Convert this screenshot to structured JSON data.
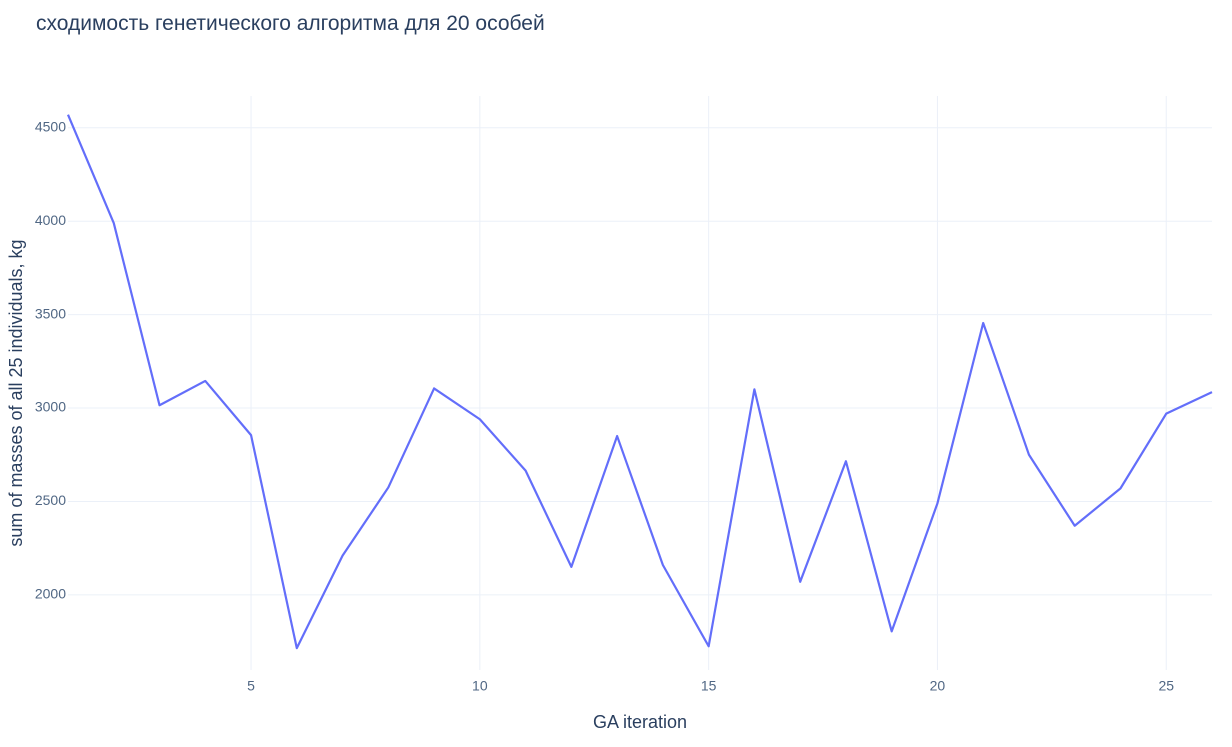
{
  "chart_data": {
    "type": "line",
    "title": "сходимость генетического алгоритма для 20 особей",
    "xlabel": "GA iteration",
    "ylabel": "sum of masses of all 25 individuals, kg",
    "x": [
      1,
      2,
      3,
      4,
      5,
      6,
      7,
      8,
      9,
      10,
      11,
      12,
      13,
      14,
      15,
      16,
      17,
      18,
      19,
      20,
      21,
      22,
      23,
      24,
      25,
      26
    ],
    "series": [
      {
        "values": [
          4570,
          3990,
          3015,
          3145,
          2855,
          1715,
          2210,
          2575,
          3105,
          2940,
          2665,
          2150,
          2850,
          2160,
          1725,
          3100,
          2070,
          2715,
          1805,
          2490,
          3455,
          2750,
          2370,
          2570,
          2970,
          3085
        ],
        "color": "#636efa"
      }
    ],
    "xlim": [
      1,
      26
    ],
    "ylim": [
      1598,
      4670
    ],
    "xticks": [
      5,
      10,
      15,
      20,
      25
    ],
    "yticks": [
      2000,
      2500,
      3000,
      3500,
      4000,
      4500
    ],
    "grid": true,
    "legend": "none"
  }
}
